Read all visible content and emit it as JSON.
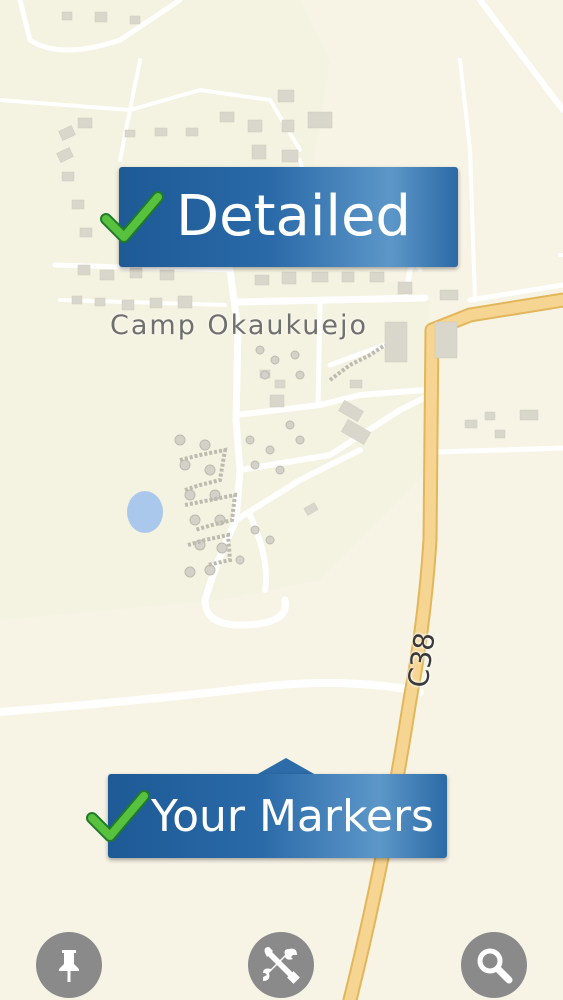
{
  "map": {
    "place_label": "Camp Okaukuejo",
    "road_label": "C38",
    "colors": {
      "land": "#f7f4e6",
      "park_area": "#f2f1df",
      "minor_road": "#ffffff",
      "major_road": "#f4d48c",
      "major_road_casing": "#e4b75c",
      "building": "#d9d6cc",
      "water": "#a9c8ec"
    }
  },
  "banners": {
    "detailed": {
      "label": "Detailed",
      "checked": true
    },
    "markers": {
      "label": "Your Markers",
      "checked": true
    }
  },
  "toolbar": {
    "buttons": [
      {
        "id": "pin",
        "icon": "pushpin-icon"
      },
      {
        "id": "tools",
        "icon": "tools-icon"
      },
      {
        "id": "search",
        "icon": "magnifier-icon"
      }
    ]
  }
}
